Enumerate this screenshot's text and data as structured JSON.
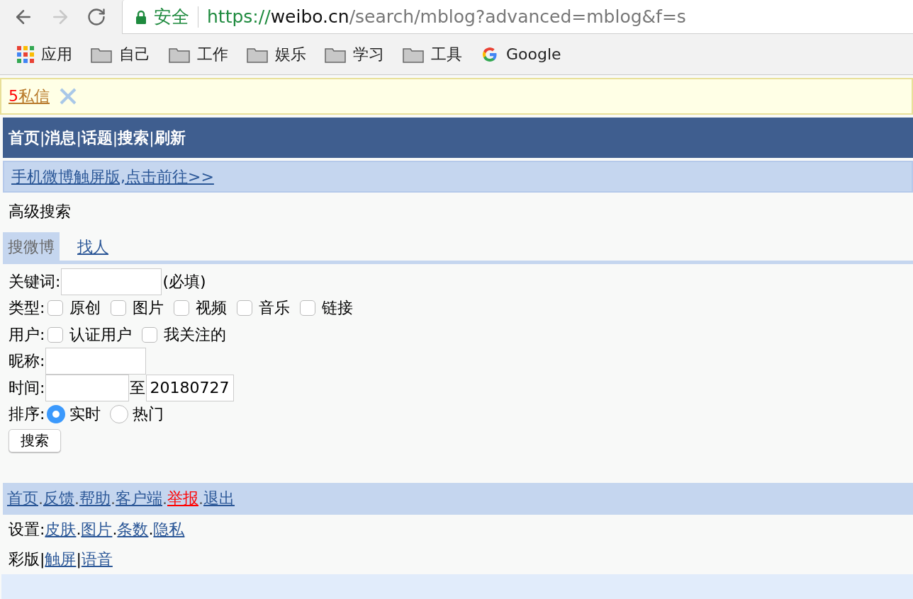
{
  "browser": {
    "secure_label": "安全",
    "url": {
      "scheme": "https://",
      "host": "weibo.cn",
      "path": "/search/mblog?advanced=mblog&f=s"
    },
    "bookmarks": [
      {
        "label": "应用",
        "kind": "apps"
      },
      {
        "label": "自己",
        "kind": "folder"
      },
      {
        "label": "工作",
        "kind": "folder"
      },
      {
        "label": "娱乐",
        "kind": "folder"
      },
      {
        "label": "学习",
        "kind": "folder"
      },
      {
        "label": "工具",
        "kind": "folder"
      },
      {
        "label": "Google",
        "kind": "google"
      }
    ]
  },
  "notice": {
    "count": "5",
    "label": "私信"
  },
  "top_nav": {
    "separator": "|",
    "items": [
      "首页",
      "消息",
      "话题",
      "搜索",
      "刷新"
    ]
  },
  "touch_banner": "手机微博触屏版,点击前往>>",
  "heading": "高级搜索",
  "tabs": [
    {
      "label": "搜微博",
      "selected": true
    },
    {
      "label": "找人",
      "selected": false
    }
  ],
  "form": [
    {
      "kind": "text",
      "label": "关键词:",
      "suffix": "(必填)"
    },
    {
      "kind": "checks",
      "label": "类型:",
      "options": [
        {
          "label": "原创",
          "checked": false
        },
        {
          "label": "图片",
          "checked": false
        },
        {
          "label": "视频",
          "checked": false
        },
        {
          "label": "音乐",
          "checked": false
        },
        {
          "label": "链接",
          "checked": false
        }
      ]
    },
    {
      "kind": "checks",
      "label": "用户:",
      "options": [
        {
          "label": "认证用户",
          "checked": false
        },
        {
          "label": "我关注的",
          "checked": false
        }
      ]
    },
    {
      "kind": "text",
      "label": "昵称:"
    },
    {
      "kind": "range",
      "label": "时间:",
      "joiner": "至",
      "to_value": "20180727"
    },
    {
      "kind": "radios",
      "label": "排序:",
      "options": [
        {
          "label": "实时",
          "selected": true
        },
        {
          "label": "热门",
          "selected": false
        }
      ]
    }
  ],
  "submit": "搜索",
  "footer_links": {
    "separator": ".",
    "items": [
      {
        "label": "首页",
        "color": "#2b5797"
      },
      {
        "label": "反馈",
        "color": "#2b5797"
      },
      {
        "label": "帮助",
        "color": "#2b5797"
      },
      {
        "label": "客户端",
        "color": "#2b5797"
      },
      {
        "label": "举报",
        "color": "#ff0000"
      },
      {
        "label": "退出",
        "color": "#2b5797"
      }
    ]
  },
  "settings": {
    "label": "设置:",
    "separator": ".",
    "links": [
      "皮肤",
      "图片",
      "条数",
      "隐私"
    ]
  },
  "versions": {
    "current": "彩版",
    "separator": "|",
    "links": [
      "触屏",
      "语音"
    ]
  }
}
